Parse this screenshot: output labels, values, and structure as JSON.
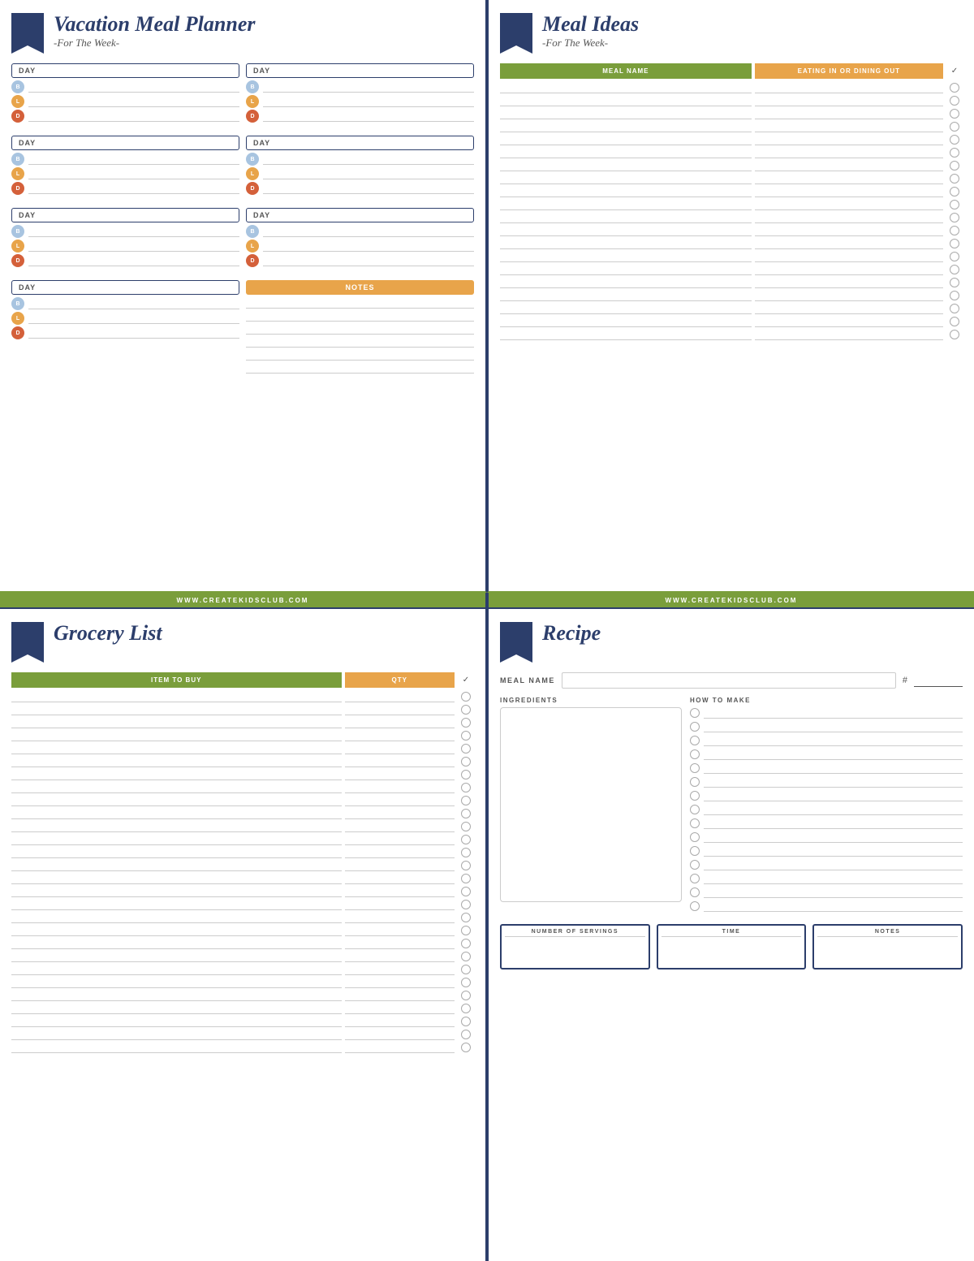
{
  "planner": {
    "title": "Vacation Meal Planner",
    "subtitle": "-For The Week-",
    "website": "WWW.CREATEKIDSCLUB.COM",
    "day_label": "DAY",
    "meal_labels": {
      "b": "B",
      "l": "L",
      "d": "D"
    },
    "notes_label": "NOTES",
    "days_count": 7
  },
  "meal_ideas": {
    "title": "Meal Ideas",
    "subtitle": "-For The Week-",
    "website": "WWW.CREATEKIDSCLUB.COM",
    "col1": "MEAL NAME",
    "col2": "EATING IN OR DINING OUT",
    "check": "✓",
    "rows": 20
  },
  "grocery": {
    "title": "Grocery List",
    "col1": "ITEM TO BUY",
    "col2": "QTY",
    "check": "✓",
    "rows": 30
  },
  "recipe": {
    "title": "Recipe",
    "meal_name_label": "MEAL NAME",
    "hash_label": "#",
    "ingredients_label": "INGREDIENTS",
    "how_to_make_label": "HOW TO MAKE",
    "footer": {
      "servings": "NUMBER OF SERVINGS",
      "time": "TIME",
      "notes": "NOTES"
    },
    "how_rows": 15
  }
}
